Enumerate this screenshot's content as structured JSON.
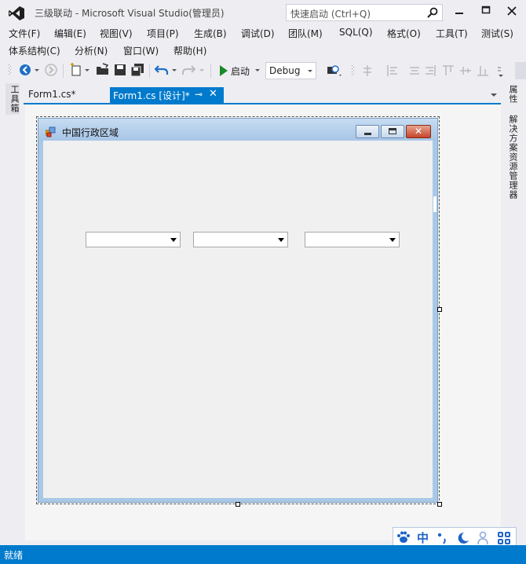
{
  "window": {
    "title": "三级联动 - Microsoft Visual Studio(管理员)",
    "quick_launch_placeholder": "快速启动 (Ctrl+Q)"
  },
  "menu_row1": [
    "文件(F)",
    "编辑(E)",
    "视图(V)",
    "项目(P)",
    "生成(B)",
    "调试(D)",
    "团队(M)",
    "SQL(Q)",
    "格式(O)",
    "工具(T)",
    "测试(S)"
  ],
  "menu_row2": [
    "体系结构(C)",
    "分析(N)",
    "窗口(W)",
    "帮助(H)"
  ],
  "toolbar": {
    "start_label": "启动",
    "config_value": "Debug"
  },
  "left_strip": {
    "toolbox_label": "工具箱"
  },
  "right_strip": {
    "properties_label": "属性",
    "solution_explorer_label": "解决方案资源管理器"
  },
  "tabs": [
    {
      "label": "Form1.cs*",
      "active": false
    },
    {
      "label": "Form1.cs [设计]*",
      "active": true
    }
  ],
  "form": {
    "title": "中国行政区域",
    "combos": [
      "",
      "",
      ""
    ]
  },
  "ime": {
    "mode_label": "中"
  },
  "status": {
    "text": "就绪"
  },
  "colors": {
    "accent": "#007acc",
    "status_bar": "#007acc",
    "chrome": "#eeeef2"
  }
}
